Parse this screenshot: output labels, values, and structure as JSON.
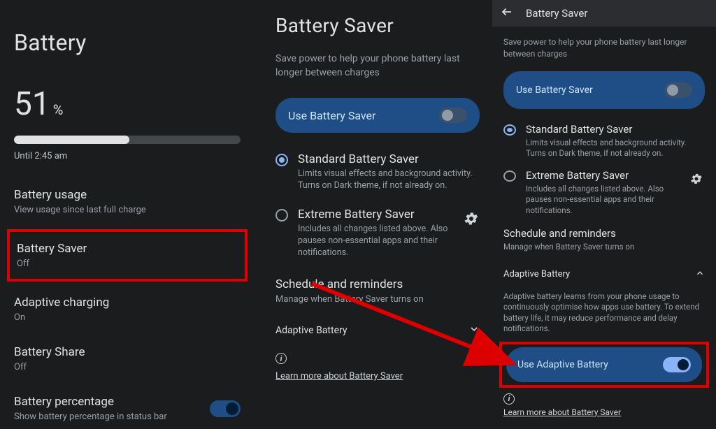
{
  "col1": {
    "title": "Battery",
    "percent_num": "51",
    "percent_sym": "%",
    "percent_fill": 51,
    "until": "Until 2:45 am",
    "usage": {
      "label": "Battery usage",
      "sub": "View usage since last full charge"
    },
    "saver": {
      "label": "Battery Saver",
      "sub": "Off"
    },
    "adaptive_charging": {
      "label": "Adaptive charging",
      "sub": "On"
    },
    "share": {
      "label": "Battery Share",
      "sub": "Off"
    },
    "percentage": {
      "label": "Battery percentage",
      "sub": "Show battery percentage in status bar"
    }
  },
  "col2": {
    "title": "Battery Saver",
    "desc": "Save power to help your phone battery last longer between charges",
    "use_label": "Use Battery Saver",
    "std": {
      "title": "Standard Battery Saver",
      "sub": "Limits visual effects and background activity. Turns on Dark theme, if not already on."
    },
    "ext": {
      "title": "Extreme Battery Saver",
      "sub": "Includes all changes listed above. Also pauses non-essential apps and their notifications."
    },
    "schedule": {
      "title": "Schedule and reminders",
      "sub": "Manage when Battery Saver turns on"
    },
    "adaptive_label": "Adaptive Battery",
    "learn": "Learn more about Battery Saver"
  },
  "col3": {
    "top_title": "Battery Saver",
    "desc": "Save power to help your phone battery last longer between charges",
    "use_label": "Use Battery Saver",
    "std": {
      "title": "Standard Battery Saver",
      "sub": "Limits visual effects and background activity. Turns on Dark theme, if not already on."
    },
    "ext": {
      "title": "Extreme Battery Saver",
      "sub": "Includes all changes listed above. Also pauses non-essential apps and their notifications."
    },
    "schedule": {
      "title": "Schedule and reminders",
      "sub": "Manage when Battery Saver turns on"
    },
    "adaptive_label": "Adaptive Battery",
    "adaptive_desc": "Adaptive battery learns from your phone usage to continuously optimise how apps use battery. To extend battery life, it may reduce performance and delay notifications.",
    "use_adaptive": "Use Adaptive Battery",
    "learn": "Learn more about Battery Saver"
  }
}
